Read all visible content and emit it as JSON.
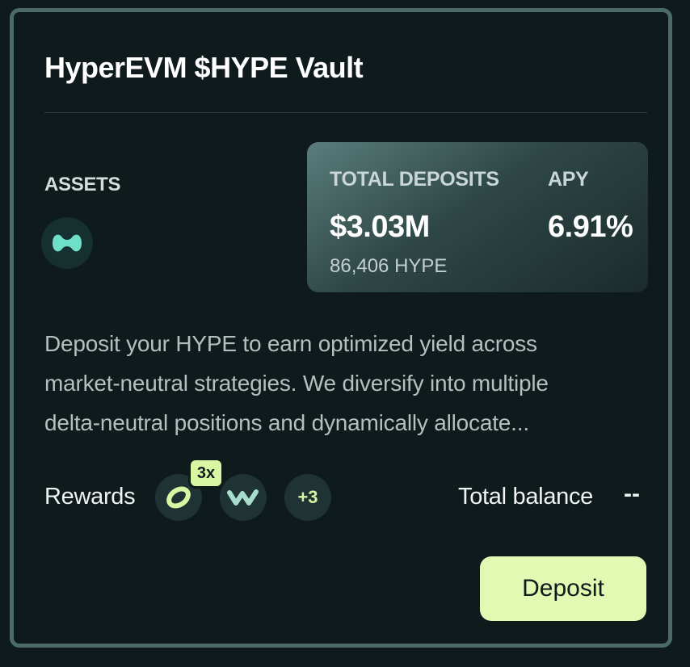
{
  "vault": {
    "title": "HyperEVM $HYPE Vault",
    "assets_label": "ASSETS",
    "asset_icon": "hype-token-icon"
  },
  "stats": {
    "total_deposits_label": "TOTAL DEPOSITS",
    "total_deposits_value": "$3.03M",
    "total_deposits_sub": "86,406 HYPE",
    "apy_label": "APY",
    "apy_value": "6.91%"
  },
  "description": {
    "lines": [
      "Deposit your HYPE to earn optimized yield across",
      "market-neutral strategies. We diversify into multiple",
      "delta-neutral positions and dynamically allocate..."
    ]
  },
  "rewards": {
    "label": "Rewards",
    "multiplier": "3x",
    "icons": [
      "reward-token-a-icon",
      "reward-token-w-icon"
    ],
    "more_count": "+3"
  },
  "balance": {
    "label": "Total balance",
    "value": "--"
  },
  "actions": {
    "deposit_label": "Deposit"
  },
  "colors": {
    "accent": "#e2f8b3",
    "asset_teal": "#6fe0c8",
    "border": "#4b6a69",
    "background": "#0f1a1c"
  }
}
